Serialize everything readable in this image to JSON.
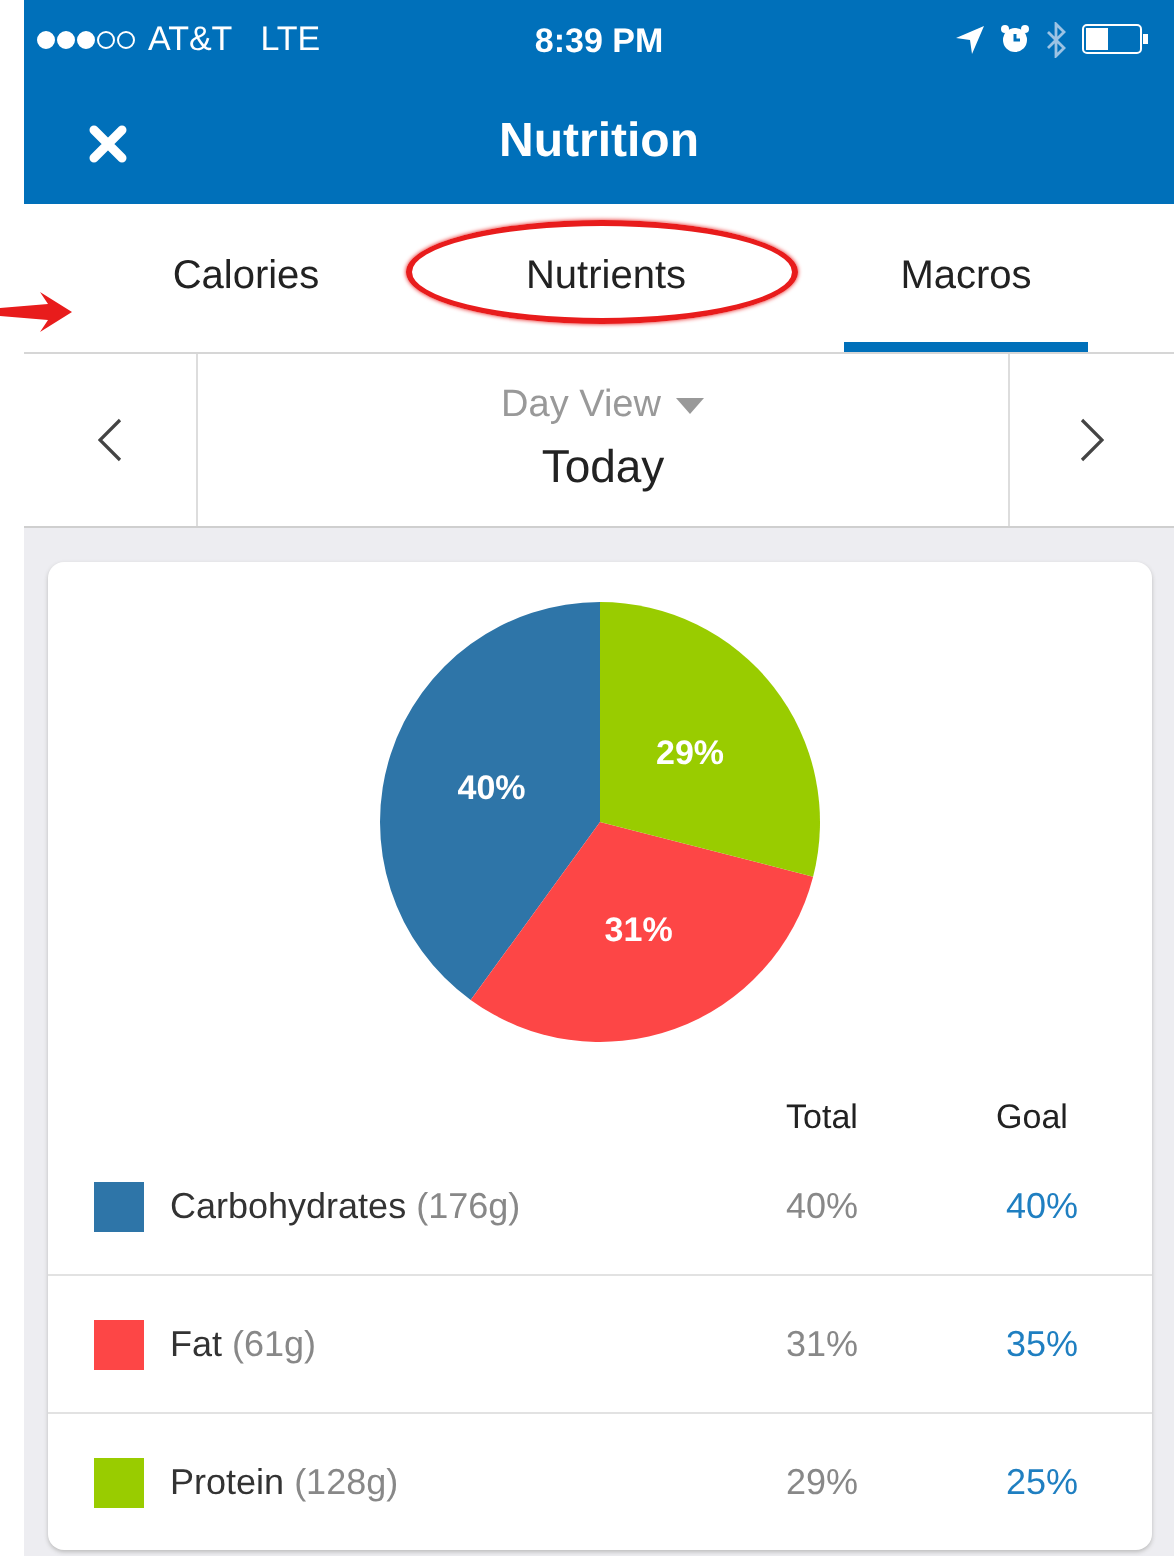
{
  "status_bar": {
    "carrier": "AT&T",
    "network": "LTE",
    "time": "8:39 PM"
  },
  "header": {
    "title": "Nutrition"
  },
  "tabs": [
    {
      "label": "Calories",
      "selected": false,
      "circled": false
    },
    {
      "label": "Nutrients",
      "selected": false,
      "circled": true
    },
    {
      "label": "Macros",
      "selected": true,
      "circled": false
    }
  ],
  "annotations": [
    {
      "kind": "arrow"
    }
  ],
  "date_nav": {
    "view_label": "Day View",
    "date": "Today"
  },
  "macros": {
    "chart_data": {
      "type": "pie",
      "values": [
        40,
        31,
        29
      ],
      "colors": [
        "#2e75a8",
        "#fd4646",
        "#99cc00"
      ],
      "value_labels": [
        "40%",
        "31%",
        "29%"
      ]
    },
    "columns": [
      "Total",
      "Goal"
    ],
    "rows": [
      {
        "name": "Carbohydrates",
        "amount": "(176g)",
        "color": "#2e75a8",
        "total": "40%",
        "goal": "40%"
      },
      {
        "name": "Fat",
        "amount": "(61g)",
        "color": "#fd4646",
        "total": "31%",
        "goal": "35%"
      },
      {
        "name": "Protein",
        "amount": "(128g)",
        "color": "#99cc00",
        "total": "29%",
        "goal": "25%"
      }
    ]
  }
}
